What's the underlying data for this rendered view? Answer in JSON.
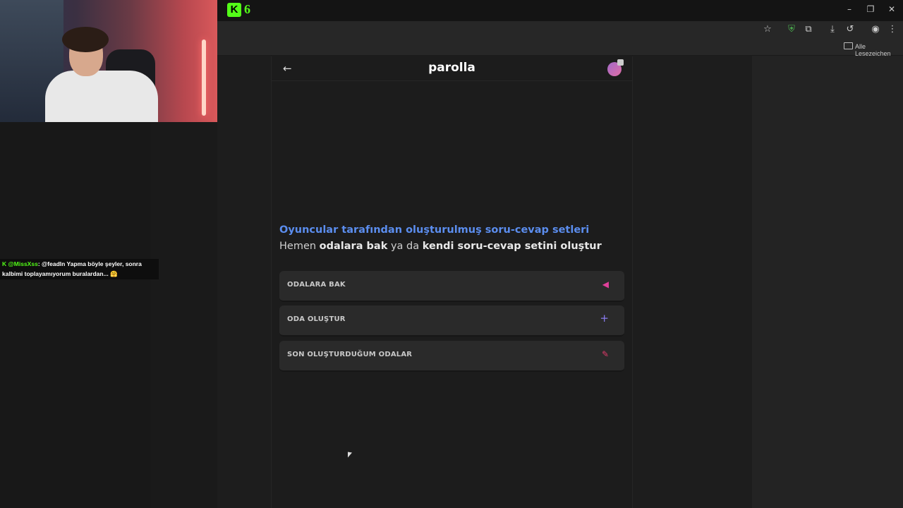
{
  "browser": {
    "tab_count": "6",
    "bookmarks_folder": "Alle Lesezeichen",
    "toolbar_icons": [
      "star-icon",
      "extension-shield-icon",
      "puzzle-icon",
      "download-icon",
      "history-icon",
      "profile-icon",
      "menu-kebab-icon"
    ],
    "window_controls": {
      "minimize": "–",
      "restore": "❐",
      "close": "✕"
    }
  },
  "stream": {
    "chat_message": {
      "user": "@MissXss",
      "text_line1": ": @feadln Yapma böyle şeyler, sonra",
      "text_line2": "kalbimi toplayamıyorum buralardan... 🤗"
    }
  },
  "app": {
    "logo": "parolla",
    "headline": "Oyuncular tarafından oluşturulmuş soru-cevap setleri",
    "subline": {
      "part1": "Hemen ",
      "bold1": "odalara bak",
      "part2": " ya da ",
      "bold2": "kendi soru-cevap setini oluştur"
    },
    "menu": [
      {
        "label": "ODALARA BAK",
        "icon": "megaphone-icon",
        "icon_color": "#e0409a"
      },
      {
        "label": "ODA OLUŞTUR",
        "icon": "plus-icon",
        "icon_color": "#8a7cf0"
      },
      {
        "label": "SON OLUŞTURDUĞUM ODALAR",
        "icon": "pin-icon",
        "icon_color": "#e03a6a"
      }
    ],
    "colors": {
      "accent": "#5b8dee",
      "brand_green": "#53fc18"
    }
  }
}
